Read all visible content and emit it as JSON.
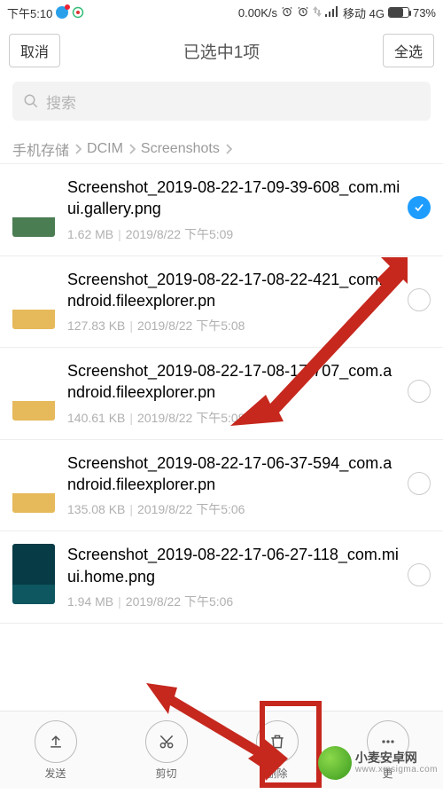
{
  "status": {
    "time": "下午5:10",
    "net_speed": "0.00K/s",
    "carrier": "移动 4G",
    "battery_pct": "73%",
    "battery_level_css_width": "73%"
  },
  "topbar": {
    "cancel": "取消",
    "title": "已选中1项",
    "select_all": "全选"
  },
  "search": {
    "placeholder": "搜索"
  },
  "crumbs": {
    "a": "手机存储",
    "b": "DCIM",
    "c": "Screenshots"
  },
  "files": [
    {
      "name": "Screenshot_2019-08-22-17-09-39-608_com.miui.gallery.png",
      "size": "1.62 MB",
      "date": "2019/8/22 下午5:09",
      "selected": true
    },
    {
      "name": "Screenshot_2019-08-22-17-08-22-421_com.android.fileexplorer.pn",
      "size": "127.83 KB",
      "date": "2019/8/22 下午5:08",
      "selected": false
    },
    {
      "name": "Screenshot_2019-08-22-17-08-17-707_com.android.fileexplorer.pn",
      "size": "140.61 KB",
      "date": "2019/8/22 下午5:08",
      "selected": false
    },
    {
      "name": "Screenshot_2019-08-22-17-06-37-594_com.android.fileexplorer.pn",
      "size": "135.08 KB",
      "date": "2019/8/22 下午5:06",
      "selected": false
    },
    {
      "name": "Screenshot_2019-08-22-17-06-27-118_com.miui.home.png",
      "size": "1.94 MB",
      "date": "2019/8/22 下午5:06",
      "selected": false
    }
  ],
  "actions": {
    "send": "发送",
    "cut": "剪切",
    "delete_": "删除",
    "more": "更"
  },
  "watermark": {
    "brand": "小麦安卓网",
    "domain": "www.xmsigma.com"
  }
}
